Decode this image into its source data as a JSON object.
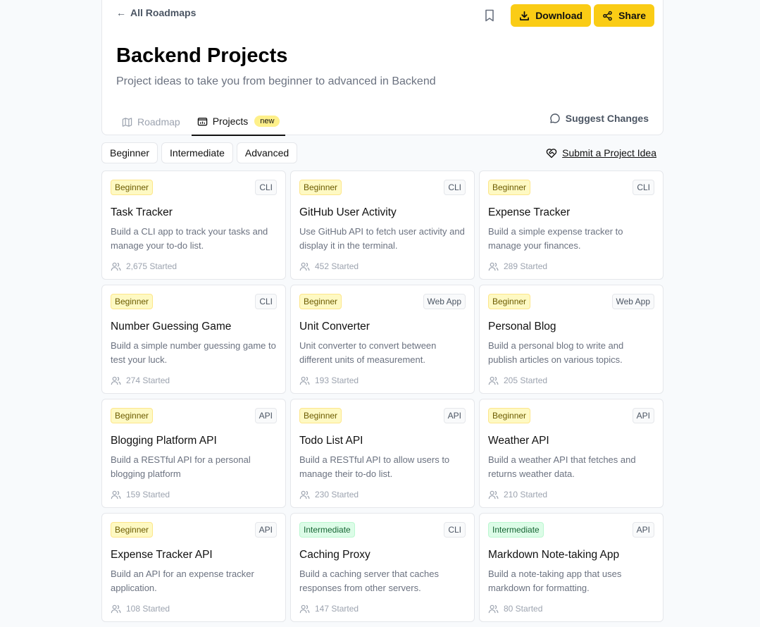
{
  "header": {
    "back_label": "All Roadmaps",
    "download_label": "Download",
    "share_label": "Share",
    "title": "Backend Projects",
    "subtitle": "Project ideas to take you from beginner to advanced in Backend",
    "tabs": [
      {
        "label": "Roadmap",
        "icon": "map-icon",
        "active": false
      },
      {
        "label": "Projects",
        "icon": "projects-icon",
        "active": true,
        "badge": "new"
      }
    ],
    "suggest_label": "Suggest Changes"
  },
  "filters": [
    "Beginner",
    "Intermediate",
    "Advanced"
  ],
  "submit_idea_label": "Submit a Project Idea",
  "colors": {
    "accent": "#facc15",
    "beginner": "#fef9c3",
    "intermediate": "#dcfce7"
  },
  "projects": [
    {
      "level": "Beginner",
      "kind": "CLI",
      "title": "Task Tracker",
      "desc": "Build a CLI app to track your tasks and manage your to-do list.",
      "started": "2,675 Started"
    },
    {
      "level": "Beginner",
      "kind": "CLI",
      "title": "GitHub User Activity",
      "desc": "Use GitHub API to fetch user activity and display it in the terminal.",
      "started": "452 Started"
    },
    {
      "level": "Beginner",
      "kind": "CLI",
      "title": "Expense Tracker",
      "desc": "Build a simple expense tracker to manage your finances.",
      "started": "289 Started"
    },
    {
      "level": "Beginner",
      "kind": "CLI",
      "title": "Number Guessing Game",
      "desc": "Build a simple number guessing game to test your luck.",
      "started": "274 Started"
    },
    {
      "level": "Beginner",
      "kind": "Web App",
      "title": "Unit Converter",
      "desc": "Unit converter to convert between different units of measurement.",
      "started": "193 Started"
    },
    {
      "level": "Beginner",
      "kind": "Web App",
      "title": "Personal Blog",
      "desc": "Build a personal blog to write and publish articles on various topics.",
      "started": "205 Started"
    },
    {
      "level": "Beginner",
      "kind": "API",
      "title": "Blogging Platform API",
      "desc": "Build a RESTful API for a personal blogging platform",
      "started": "159 Started"
    },
    {
      "level": "Beginner",
      "kind": "API",
      "title": "Todo List API",
      "desc": "Build a RESTful API to allow users to manage their to-do list.",
      "started": "230 Started"
    },
    {
      "level": "Beginner",
      "kind": "API",
      "title": "Weather API",
      "desc": "Build a weather API that fetches and returns weather data.",
      "started": "210 Started"
    },
    {
      "level": "Beginner",
      "kind": "API",
      "title": "Expense Tracker API",
      "desc": "Build an API for an expense tracker application.",
      "started": "108 Started"
    },
    {
      "level": "Intermediate",
      "kind": "CLI",
      "title": "Caching Proxy",
      "desc": "Build a caching server that caches responses from other servers.",
      "started": "147 Started"
    },
    {
      "level": "Intermediate",
      "kind": "API",
      "title": "Markdown Note-taking App",
      "desc": "Build a note-taking app that uses markdown for formatting.",
      "started": "80 Started"
    }
  ]
}
